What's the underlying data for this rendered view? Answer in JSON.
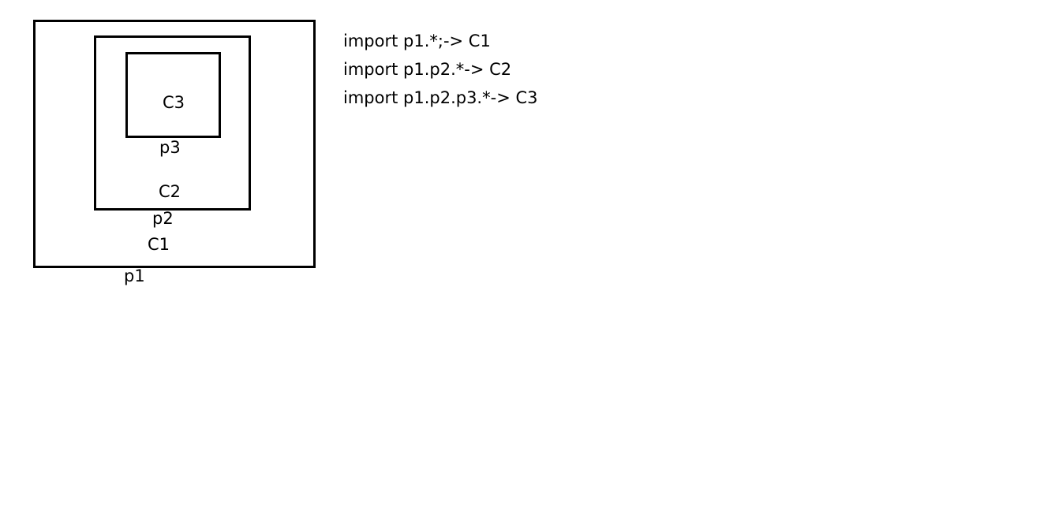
{
  "diagram": {
    "packages": {
      "p1": {
        "package_label": "p1",
        "class_label": "C1"
      },
      "p2": {
        "package_label": "p2",
        "class_label": "C2"
      },
      "p3": {
        "package_label": "p3",
        "class_label": "C3"
      }
    },
    "imports": [
      "import p1.*;-> C1",
      "import p1.p2.*-> C2",
      "import p1.p2.p3.*-> C3"
    ],
    "colors": {
      "stroke": "#000000",
      "background": "#ffffff"
    }
  }
}
